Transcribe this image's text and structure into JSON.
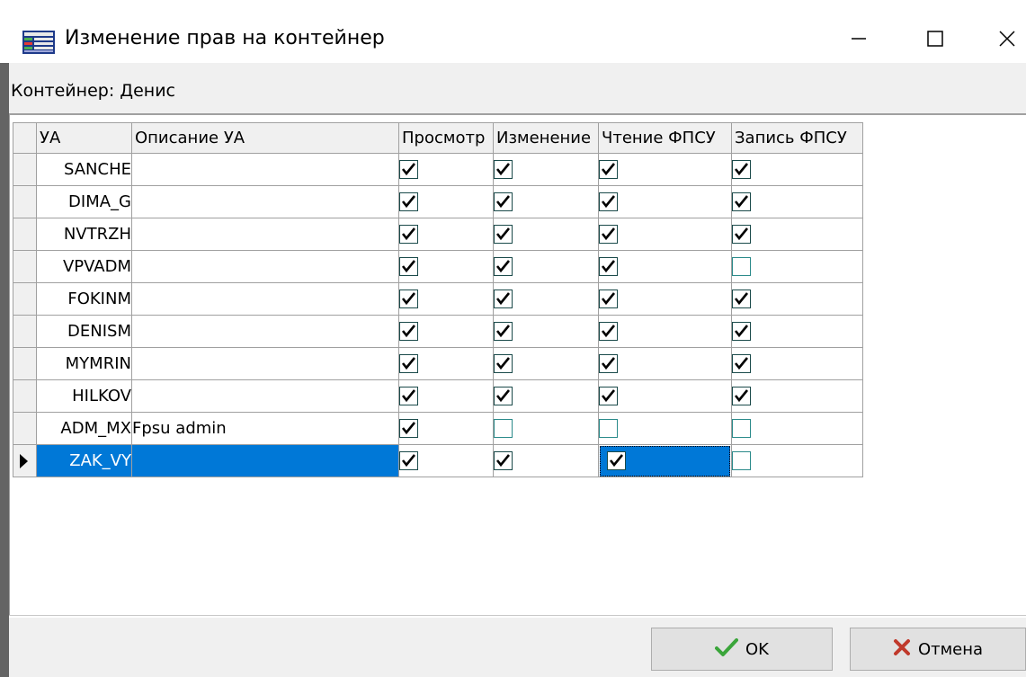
{
  "window": {
    "title": "Изменение прав на контейнер",
    "icon": "table-app-icon"
  },
  "container_label": "Контейнер: Денис",
  "grid": {
    "columns": [
      "УА",
      "Описание УА",
      "Просмотр",
      "Изменение",
      "Чтение ФПСУ",
      "Запись ФПСУ"
    ],
    "rows": [
      {
        "ua": "SANCHE",
        "desc": "",
        "view": true,
        "change": true,
        "read": true,
        "write": true
      },
      {
        "ua": "DIMA_G",
        "desc": "",
        "view": true,
        "change": true,
        "read": true,
        "write": true
      },
      {
        "ua": "NVTRZH",
        "desc": "",
        "view": true,
        "change": true,
        "read": true,
        "write": true
      },
      {
        "ua": "VPVADM",
        "desc": "",
        "view": true,
        "change": true,
        "read": true,
        "write": false
      },
      {
        "ua": "FOKINM",
        "desc": "",
        "view": true,
        "change": true,
        "read": true,
        "write": true
      },
      {
        "ua": "DENISM",
        "desc": "",
        "view": true,
        "change": true,
        "read": true,
        "write": true
      },
      {
        "ua": "MYMRIN",
        "desc": "",
        "view": true,
        "change": true,
        "read": true,
        "write": true
      },
      {
        "ua": "HILKOV",
        "desc": "",
        "view": true,
        "change": true,
        "read": true,
        "write": true
      },
      {
        "ua": "ADM_MX",
        "desc": "Fpsu admin",
        "view": true,
        "change": false,
        "read": false,
        "write": false
      },
      {
        "ua": "ZAK_VY",
        "desc": "",
        "view": true,
        "change": true,
        "read": true,
        "write": false,
        "selected": true
      }
    ]
  },
  "buttons": {
    "ok_label": "OK",
    "cancel_label": "Отмена"
  },
  "colors": {
    "selection": "#0078d7",
    "ok_check": "#3aa53a",
    "cancel_x": "#c0392b"
  }
}
